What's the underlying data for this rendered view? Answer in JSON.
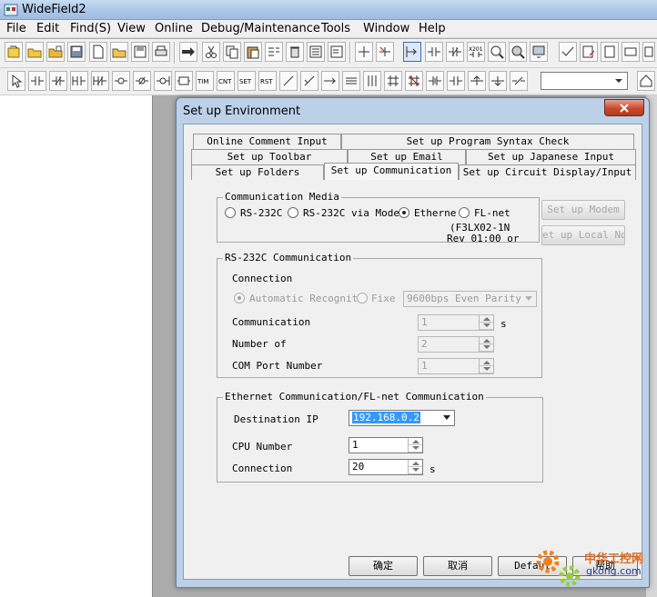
{
  "app": {
    "title": "WideField2"
  },
  "menu": [
    "File",
    "Edit",
    "Find(S)",
    "View",
    "Online",
    "Debug/Maintenance",
    "Tools",
    "Window",
    "Help"
  ],
  "toolbar_ladder_labels": {
    "tim": "TIM",
    "cnt": "CNT",
    "set": "SET",
    "rst": "RST",
    "x201": "X201"
  },
  "dialog": {
    "title": "Set up Environment",
    "tabs": {
      "row1": [
        "Online Comment Input",
        "Set up Program Syntax Check"
      ],
      "row2": [
        "Set up Toolbar",
        "Set up Email",
        "Set up Japanese Input"
      ],
      "row3": [
        "Set up Folders",
        "Set up Communication",
        "Set up Circuit Display/Input"
      ]
    },
    "media": {
      "title": "Communication Media",
      "options": [
        "RS-232C",
        "RS-232C via Moden",
        "Etherne",
        "FL-net"
      ],
      "selected": "Etherne",
      "fl_net_note": [
        "(F3LX02-1N",
        "Rev 01:00 or"
      ],
      "btn_modem": "Set up Modem",
      "btn_local": "et up Local Nod"
    },
    "rs232c": {
      "title": "RS-232C Communication",
      "connection": "Connection",
      "auto": "Automatic Recogniti",
      "fixed": "Fixe",
      "parity_value": "9600bps Even Parity",
      "comm_label": "Communication",
      "comm_value": "1",
      "comm_unit": "s",
      "number_label": "Number of",
      "number_value": "2",
      "com_port_label": "COM Port Number",
      "com_port_value": "1"
    },
    "ethernet": {
      "title": "Ethernet Communication/FL-net Communication",
      "dest_ip_label": "Destination IP",
      "dest_ip_value": "192.168.0.2",
      "cpu_label": "CPU Number",
      "cpu_value": "1",
      "conn_label": "Connection",
      "conn_value": "20",
      "conn_unit": "s"
    },
    "buttons": {
      "ok": "确定",
      "cancel": "取消",
      "default": "Defaul",
      "help": "帮助"
    }
  },
  "watermark": {
    "cn": "中华工控网",
    "url": "gkong.com"
  }
}
